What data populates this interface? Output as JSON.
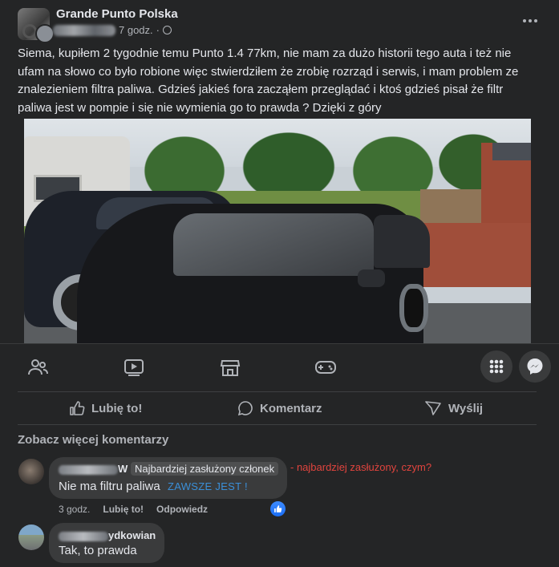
{
  "post": {
    "group_name": "Grande Punto Polska",
    "time": "7 godz.",
    "separator": "·",
    "privacy_icon": "globe-icon",
    "more_icon": "more-horizontal-icon",
    "text": "Siema, kupiłem 2 tygodnie temu Punto 1.4 77km, nie mam za dużo historii tego auta  i też nie ufam na słowo co było robione więc stwierdziłem że zrobię rozrząd i serwis, i mam problem ze znalezieniem filtra paliwa. Gdzieś jakieś fora zacząłem przeglądać i ktoś gdzieś pisał że filtr paliwa jest w pompie i się nie wymienia go to prawda ? Dzięki z góry"
  },
  "navbar": {
    "icons": [
      "friends-icon",
      "watch-video-icon",
      "marketplace-icon",
      "gaming-icon",
      "menu-grid-icon",
      "messenger-icon"
    ]
  },
  "actions": {
    "like_label": "Lubię to!",
    "comment_label": "Komentarz",
    "share_label": "Wyślij"
  },
  "comments_section": {
    "see_more": "Zobacz więcej komentarzy",
    "comments": [
      {
        "author_visible": "W",
        "badge": "Najbardziej zasłużony członek",
        "text": "Nie ma filtru paliwa",
        "annotation": "ZAWSZE JEST !",
        "time": "3 godz.",
        "like_action": "Lubię to!",
        "reply_action": "Odpowiedz",
        "reaction_icon": "like-reaction-icon"
      },
      {
        "author_visible": "ydkowian",
        "text": "Tak, to prawda"
      }
    ],
    "side_annotation": "- najbardziej zasłużony, czym?"
  },
  "colors": {
    "background": "#242526",
    "text_primary": "#e4e6eb",
    "text_secondary": "#b0b3b8",
    "bubble": "#3a3b3c",
    "annotation_blue": "#3a8fd8",
    "annotation_red": "#e0443e",
    "like_blue": "#1a6ef5"
  }
}
